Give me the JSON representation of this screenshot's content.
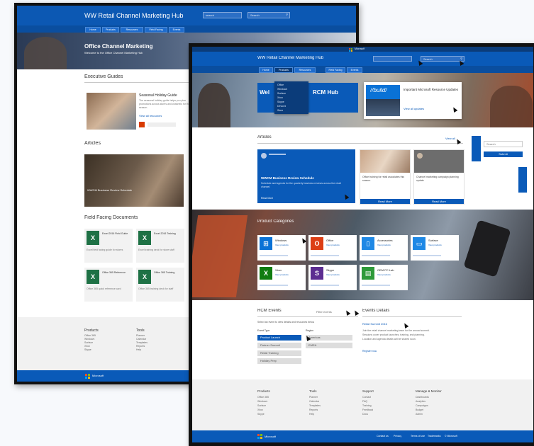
{
  "back": {
    "header_title": "WW Retail Channel Marketing Hub",
    "search_a": "search",
    "search_b": "Search",
    "nav_tabs": [
      "Home",
      "Products",
      "Resources",
      "Field Facing",
      "Events"
    ],
    "hero_title": "Office Channel Marketing",
    "hero_sub": "Welcome to the Office Channel Marketing Hub",
    "section_exec": "Executive Guides",
    "exec_card_title": "Seasonal Holiday Guide",
    "exec_card_text": "The seasonal holiday guide helps you plan promotions across stores and channels for the season.",
    "exec_card_link": "View all resources",
    "section_articles": "Articles",
    "article_caption": "WWCM Business Review Schedule",
    "section_field": "Field Facing Documents",
    "docs": [
      {
        "title": "Excel 2016 Field Guide",
        "sub": "Excel field facing guide for stores"
      },
      {
        "title": "Excel 2016 Training",
        "sub": "Excel training deck for store staff"
      },
      {
        "title": "Office 365 Reference",
        "sub": "Office 365 quick reference card"
      },
      {
        "title": "Office 365 Training",
        "sub": "Office 365 training deck for staff"
      }
    ],
    "footer_col1_title": "Products",
    "footer_col1": [
      "Office 365",
      "Windows",
      "Surface",
      "Xbox",
      "Skype"
    ],
    "footer_col2_title": "Tools",
    "footer_col2": [
      "Planner",
      "Calendar",
      "Templates",
      "Reports",
      "Help"
    ],
    "footer_brand": "Microsoft"
  },
  "front": {
    "top_brand": "Microsoft",
    "header_title": "WW Retail Channel Marketing Hub",
    "search_a": "",
    "search_b": "Search",
    "nav_tabs": [
      "Home",
      "Products",
      "Resources",
      "Field Facing",
      "Events"
    ],
    "dropdown_items": [
      "Office",
      "Windows",
      "Surface",
      "Xbox",
      "Skype",
      "Devices",
      "Store"
    ],
    "hero_left_title": "Wel",
    "hero_right_title": "RCM Hub",
    "build_logo": "//build/",
    "build_title": "Important Microsoft Resource Updates",
    "build_link": "View all updates",
    "articles_title": "Articles",
    "view_all": "View all",
    "featured_title": "WWCM Business Review Schedule",
    "featured_text": "Schedule and agenda for the quarterly business reviews across the retail channel.",
    "featured_link": "Read More",
    "card2_text": "Office training for retail associates this season",
    "card2_link": "Read More",
    "card3_text": "Channel marketing campaign planning update",
    "card3_link": "Read More",
    "side_search": "Search",
    "side_button": "Submit",
    "product_title": "Product Categories",
    "products": [
      {
        "name": "Windows",
        "sub": "View products",
        "icon": "windows-icon",
        "color": "#0a72d6"
      },
      {
        "name": "Office",
        "sub": "View products",
        "icon": "office-icon",
        "color": "#dc3e15"
      },
      {
        "name": "Accessories",
        "sub": "View products",
        "icon": "mouse-icon",
        "color": "#1e88e5"
      },
      {
        "name": "Surface",
        "sub": "View products",
        "icon": "surface-icon",
        "color": "#1e88e5"
      },
      {
        "name": "Xbox",
        "sub": "View products",
        "icon": "xbox-icon",
        "color": "#107c10"
      },
      {
        "name": "Skype",
        "sub": "View products",
        "icon": "skype-icon",
        "color": "#5c2d91"
      },
      {
        "name": "OEM PC Lab",
        "sub": "View products",
        "icon": "store-icon",
        "color": "#2e9a3a"
      }
    ],
    "events_title": "RCM Events",
    "events_filter": "Filter events",
    "events_hint": "Select an event to view details and resources below",
    "events_col1_label": "Event Type",
    "events_col2_label": "Region",
    "events_col1": [
      "Product Launch",
      "Partner Summit",
      "Retail Training",
      "Holiday Prep"
    ],
    "events_col2": [
      "Americas",
      "EMEA"
    ],
    "details_title": "Events Details",
    "details_event": "Retail Summit 2016",
    "details_lines": [
      "Join the retail channel marketing team for the annual summit.",
      "Sessions cover product launches, training, and planning.",
      "Location and agenda details will be shared soon."
    ],
    "details_link": "Register now",
    "footer_cols": [
      {
        "title": "Products",
        "items": [
          "Office 365",
          "Windows",
          "Surface",
          "Xbox",
          "Skype"
        ]
      },
      {
        "title": "Tools",
        "items": [
          "Planner",
          "Calendar",
          "Templates",
          "Reports",
          "Help"
        ]
      },
      {
        "title": "Support",
        "items": [
          "Contact",
          "FAQ",
          "Training",
          "Feedback",
          "Docs"
        ]
      },
      {
        "title": "Manage & Monitor",
        "items": [
          "Dashboards",
          "Analytics",
          "Campaigns",
          "Budget",
          "Admin"
        ]
      }
    ],
    "footer_brand": "Microsoft",
    "footer_links": [
      "Contact us",
      "Privacy",
      "Terms of use",
      "Trademarks",
      "© Microsoft"
    ]
  }
}
